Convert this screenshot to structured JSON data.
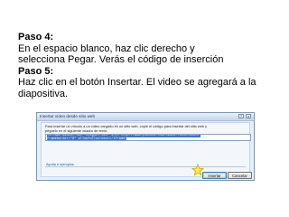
{
  "instructions": {
    "step4_title": "Paso 4:",
    "step4_line1": "En el espacio blanco, haz clic derecho y",
    "step4_line2": "selecciona Pegar. Verás el código de inserción",
    "step5_title": "Paso 5:",
    "step5_line1": "Haz clic en el botón Insertar. El video se agregará a la",
    "step5_line2": "diapositiva."
  },
  "dialog": {
    "title": "Insertar vídeo desde sitio web",
    "help_button": "?",
    "close_button": "x",
    "description_line1": "Para insertar un vínculo a un vídeo cargado en un sitio web, copie el código para insertar del sitio web y",
    "description_line2": "péguelo en el siguiente cuadro de texto:",
    "embed_code_line1": "<iframe width=\"560\" height=\"315\" src=\"http://www.youtube.com/embed/7Nb5kfBbbtI\"",
    "embed_code_line2": "frameborder=\"0\" allowfullscreen></iframe>",
    "help_link": "Ayuda e ejemplos",
    "insert_button": "Insertar",
    "cancel_button": "Cancelar"
  },
  "colors": {
    "highlight": "#3e71c8",
    "star": "#f4d90a"
  }
}
